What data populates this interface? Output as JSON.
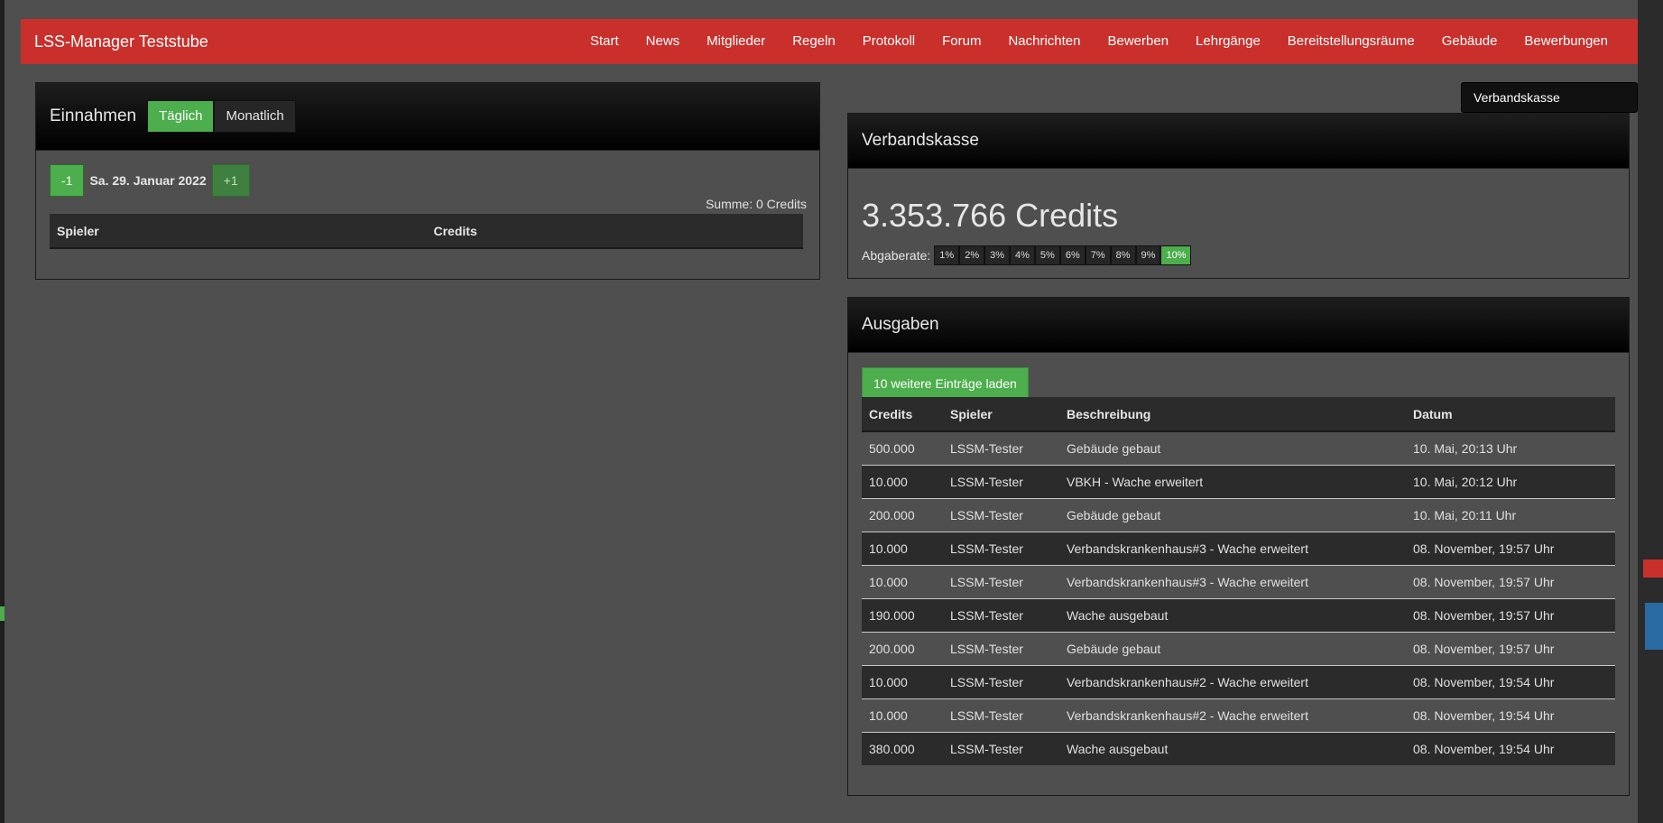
{
  "app": {
    "brand": "LSS-Manager Teststube",
    "nav": [
      "Start",
      "News",
      "Mitglieder",
      "Regeln",
      "Protokoll",
      "Forum",
      "Nachrichten",
      "Bewerben",
      "Lehrgänge",
      "Bereitstellungsräume",
      "Gebäude",
      "Bewerbungen"
    ]
  },
  "income": {
    "title": "Einnahmen",
    "tab_daily": "Täglich",
    "tab_monthly": "Monatlich",
    "prev_label": "-1",
    "next_label": "+1",
    "date": "Sa. 29. Januar 2022",
    "sum": "Summe: 0 Credits",
    "columns": [
      "Spieler",
      "Credits"
    ]
  },
  "kasse": {
    "deactivate_label": "Verbandskasse deaktivieren",
    "title": "Verbandskasse",
    "balance": "3.353.766 Credits",
    "rate_label": "Abgaberate:",
    "rates": [
      "1%",
      "2%",
      "3%",
      "4%",
      "5%",
      "6%",
      "7%",
      "8%",
      "9%",
      "10%"
    ],
    "active_rate": "10%"
  },
  "expenses": {
    "title": "Ausgaben",
    "load_more": "10 weitere Einträge laden",
    "columns": [
      "Credits",
      "Spieler",
      "Beschreibung",
      "Datum"
    ],
    "rows": [
      [
        "500.000",
        "LSSM-Tester",
        "Gebäude gebaut",
        "10. Mai, 20:13 Uhr"
      ],
      [
        "10.000",
        "LSSM-Tester",
        "VBKH - Wache erweitert",
        "10. Mai, 20:12 Uhr"
      ],
      [
        "200.000",
        "LSSM-Tester",
        "Gebäude gebaut",
        "10. Mai, 20:11 Uhr"
      ],
      [
        "10.000",
        "LSSM-Tester",
        "Verbandskrankenhaus#3 - Wache erweitert",
        "08. November, 19:57 Uhr"
      ],
      [
        "10.000",
        "LSSM-Tester",
        "Verbandskrankenhaus#3 - Wache erweitert",
        "08. November, 19:57 Uhr"
      ],
      [
        "190.000",
        "LSSM-Tester",
        "Wache ausgebaut",
        "08. November, 19:57 Uhr"
      ],
      [
        "200.000",
        "LSSM-Tester",
        "Gebäude gebaut",
        "08. November, 19:57 Uhr"
      ],
      [
        "10.000",
        "LSSM-Tester",
        "Verbandskrankenhaus#2 - Wache erweitert",
        "08. November, 19:54 Uhr"
      ],
      [
        "10.000",
        "LSSM-Tester",
        "Verbandskrankenhaus#2 - Wache erweitert",
        "08. November, 19:54 Uhr"
      ],
      [
        "380.000",
        "LSSM-Tester",
        "Wache ausgebaut",
        "08. November, 19:54 Uhr"
      ]
    ]
  }
}
